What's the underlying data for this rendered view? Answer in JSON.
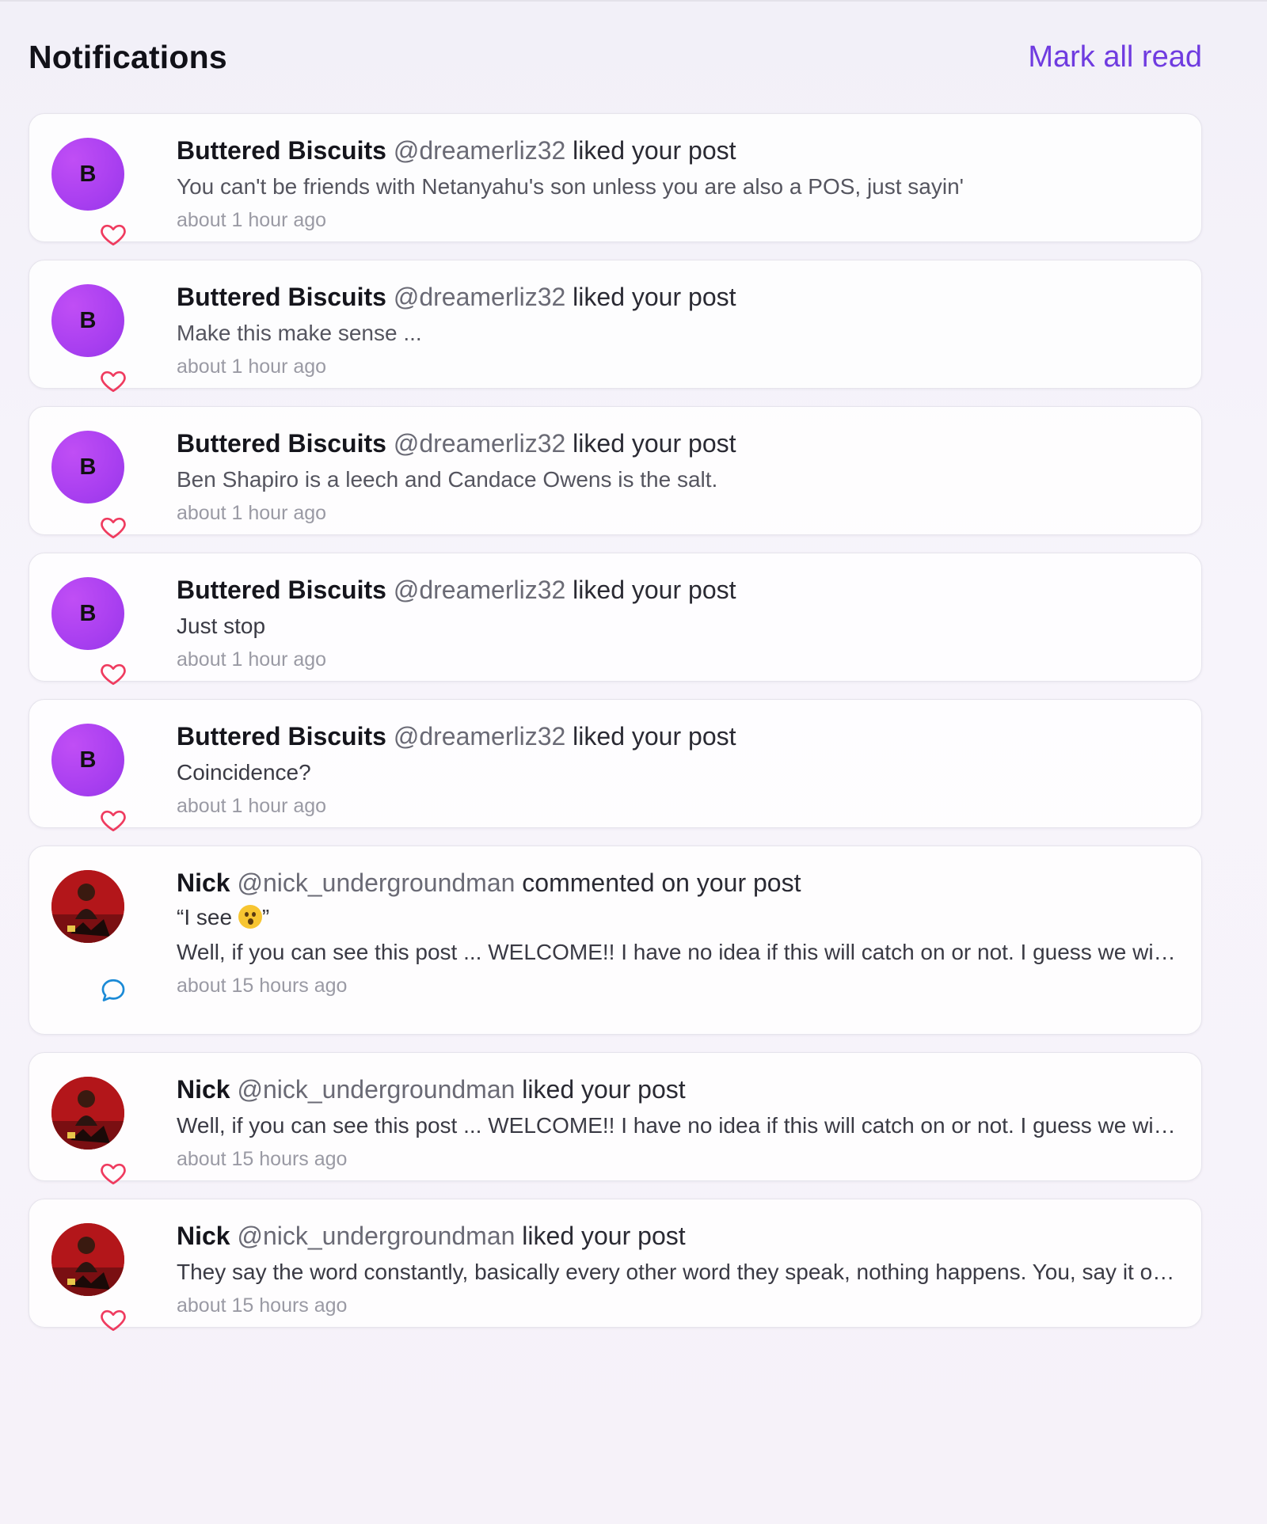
{
  "header": {
    "title": "Notifications",
    "mark_all_read": "Mark all read"
  },
  "colors": {
    "accent": "#6f3be0",
    "like_icon": "#ef3b5f",
    "comment_icon": "#1b8ad6",
    "avatar_gradient": "#a93ff0"
  },
  "notifications": [
    {
      "avatar_letter": "B",
      "name": "Buttered Biscuits",
      "handle": "@dreamerliz32",
      "action": "liked your post",
      "snippet": "You can't be friends with Netanyahu's son unless you are also a POS, just sayin'",
      "time": "about 1 hour ago",
      "icon": "heart-icon"
    },
    {
      "avatar_letter": "B",
      "name": "Buttered Biscuits",
      "handle": "@dreamerliz32",
      "action": "liked your post",
      "snippet": "Make this make sense ...",
      "time": "about 1 hour ago",
      "icon": "heart-icon"
    },
    {
      "avatar_letter": "B",
      "name": "Buttered Biscuits",
      "handle": "@dreamerliz32",
      "action": "liked your post",
      "snippet": "Ben Shapiro is a leech and Candace Owens is the salt.",
      "time": "about 1 hour ago",
      "icon": "heart-icon"
    },
    {
      "avatar_letter": "B",
      "name": "Buttered Biscuits",
      "handle": "@dreamerliz32",
      "action": "liked your post",
      "snippet": "Just stop",
      "time": "about 1 hour ago",
      "icon": "heart-icon"
    },
    {
      "avatar_letter": "B",
      "name": "Buttered Biscuits",
      "handle": "@dreamerliz32",
      "action": "liked your post",
      "snippet": "Coincidence?",
      "time": "about 1 hour ago",
      "icon": "heart-icon"
    },
    {
      "avatar_letter": "",
      "name": "Nick",
      "handle": "@nick_undergroundman",
      "action": "commented on your post",
      "comment_open": "“I see ",
      "comment_close": "”",
      "snippet": "Well, if you can see this post ... WELCOME!! I have no idea if this will catch on or not. I guess we will...",
      "time": "about 15 hours ago",
      "icon": "comment-icon"
    },
    {
      "avatar_letter": "",
      "name": "Nick",
      "handle": "@nick_undergroundman",
      "action": "liked your post",
      "snippet": "Well, if you can see this post ... WELCOME!! I have no idea if this will catch on or not. I guess we will...",
      "time": "about 15 hours ago",
      "icon": "heart-icon"
    },
    {
      "avatar_letter": "",
      "name": "Nick",
      "handle": "@nick_undergroundman",
      "action": "liked your post",
      "snippet": "They say the word constantly, basically every other word they speak, nothing happens. You, say it onc...",
      "time": "about 15 hours ago",
      "icon": "heart-icon"
    }
  ]
}
